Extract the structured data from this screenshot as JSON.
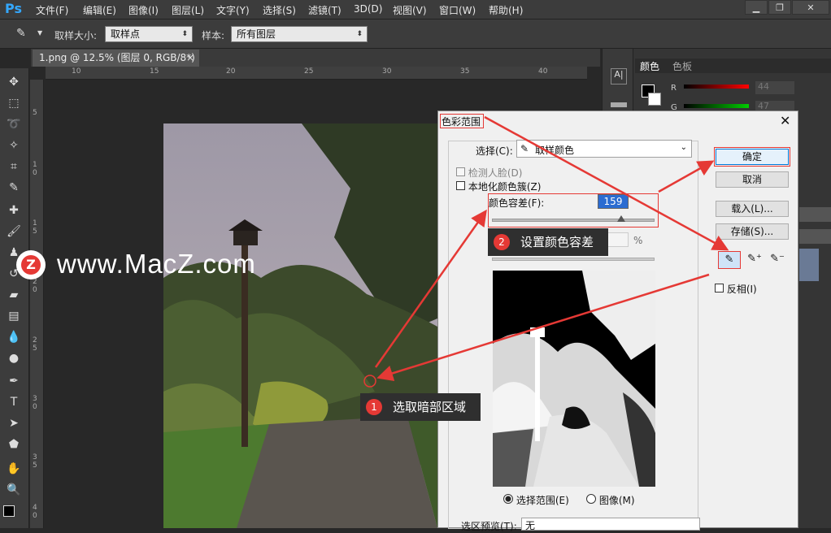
{
  "app": {
    "logo": "Ps"
  },
  "menu": [
    "文件(F)",
    "编辑(E)",
    "图像(I)",
    "图层(L)",
    "文字(Y)",
    "选择(S)",
    "滤镜(T)",
    "3D(D)",
    "视图(V)",
    "窗口(W)",
    "帮助(H)"
  ],
  "options": {
    "sample_size_label": "取样大小:",
    "sample_size_value": "取样点",
    "sample_label": "样本:",
    "sample_value": "所有图层"
  },
  "document": {
    "tab_title": "1.png @ 12.5% (图层 0, RGB/8*)"
  },
  "ruler": {
    "h": [
      "10",
      "15",
      "20",
      "25",
      "30",
      "35",
      "40"
    ],
    "v": [
      "5",
      "1 0",
      "1 5",
      "2 0",
      "2 5",
      "3 0",
      "3 5",
      "4 0"
    ]
  },
  "panel": {
    "tab_color": "颜色",
    "tab_swatches": "色板",
    "r_label": "R",
    "g_label": "G",
    "r_value": "44",
    "g_value": "47"
  },
  "watermark": "www.MacZ.com",
  "dialog": {
    "title": "色彩范围",
    "select_label": "选择(C):",
    "select_value": "取样颜色",
    "detect_faces": "检测人脸(D)",
    "localized": "本地化颜色簇(Z)",
    "fuzziness_label": "颜色容差(F):",
    "fuzziness_value": "159",
    "range_label": "范",
    "range_unit": "%",
    "ok": "确定",
    "cancel": "取消",
    "load": "载入(L)...",
    "save": "存储(S)...",
    "invert": "反相(I)",
    "radio_selection": "选择范围(E)",
    "radio_image": "图像(M)",
    "preview_label": "选区预览(T):",
    "preview_value": "无"
  },
  "annotations": {
    "step1_num": "1",
    "step1_text": "选取暗部区域",
    "step2_num": "2",
    "step2_text": "设置颜色容差"
  },
  "colors": {
    "accent_red": "#e53935",
    "ps_blue": "#34a8ff"
  }
}
